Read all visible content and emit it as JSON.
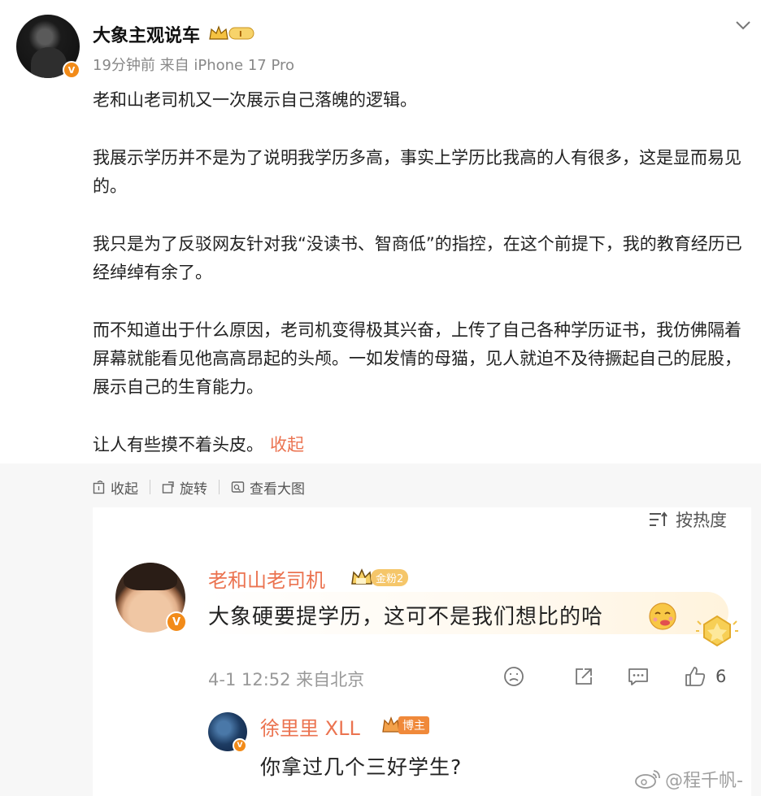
{
  "post": {
    "author": "大象主观说车",
    "time": "19分钟前",
    "source": "来自 iPhone 17 Pro",
    "verified_badge": "V",
    "paragraphs": [
      "老和山老司机又一次展示自己落魄的逻辑。",
      "我展示学历并不是为了说明我学历多高，事实上学历比我高的人有很多，这是显而易见的。",
      "我只是为了反驳网友针对我“没读书、智商低”的指控，在这个前提下，我的教育经历已经绰绰有余了。",
      "而不知道出于什么原因，老司机变得极其兴奋，上传了自己各种学历证书，我仿佛隔着屏幕就能看见他高高昂起的头颅。一如发情的母猫，见人就迫不及待撅起自己的屁股，展示自己的生育能力。",
      "让人有些摸不着头皮。"
    ],
    "collapse_label": "收起"
  },
  "image_toolbar": {
    "collapse": "收起",
    "rotate": "旋转",
    "view_large": "查看大图"
  },
  "embedded_screenshot": {
    "sort_label": "按热度",
    "comment": {
      "name": "老和山老司机",
      "fan_badge": "金粉2",
      "text": "大象硬要提学历，这可不是我们想比的哈",
      "meta": "4-1 12:52 来自北京",
      "likes": "6"
    },
    "reply": {
      "name": "徐里里 XLL",
      "badge": "博主",
      "text": "你拿过几个三好学生?"
    }
  },
  "watermark": "@程千帆-",
  "colors": {
    "accent_orange": "#eb7350",
    "verified_orange": "#f28b19",
    "meta_gray": "#888888",
    "band_gray": "#f7f7f7"
  },
  "icons": [
    "chevron-down-icon",
    "collapse-icon",
    "rotate-icon",
    "view-large-icon",
    "sort-icon",
    "dislike-icon",
    "share-icon",
    "comment-icon",
    "like-icon",
    "weibo-logo-icon"
  ]
}
